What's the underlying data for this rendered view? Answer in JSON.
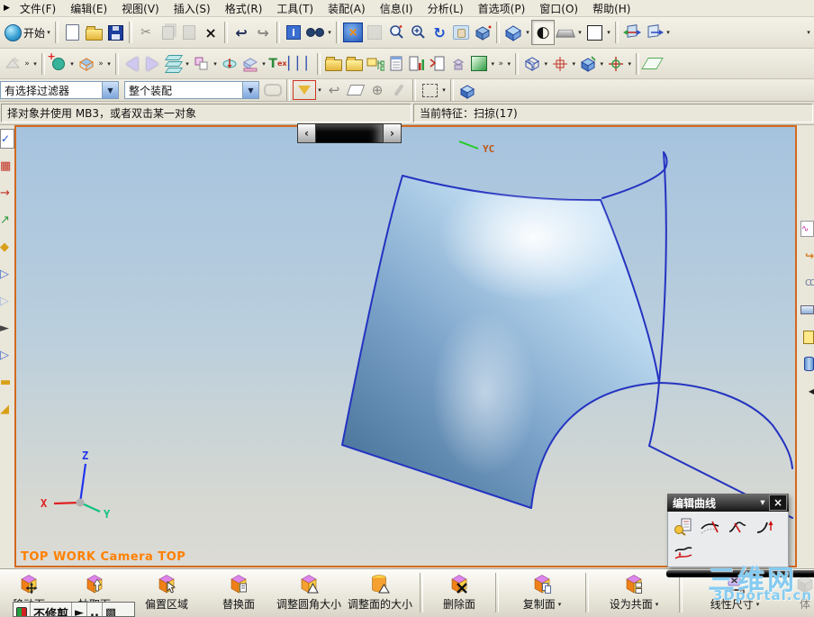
{
  "menu": {
    "items": [
      {
        "label": "文件(F)"
      },
      {
        "label": "编辑(E)"
      },
      {
        "label": "视图(V)"
      },
      {
        "label": "插入(S)"
      },
      {
        "label": "格式(R)"
      },
      {
        "label": "工具(T)"
      },
      {
        "label": "装配(A)"
      },
      {
        "label": "信息(I)"
      },
      {
        "label": "分析(L)"
      },
      {
        "label": "首选项(P)"
      },
      {
        "label": "窗口(O)"
      },
      {
        "label": "帮助(H)"
      }
    ]
  },
  "standard_toolbar": {
    "start_label": "开始"
  },
  "selection_bar": {
    "filter_value": "有选择过滤器",
    "scope_value": "整个装配"
  },
  "prompt_bar": {
    "message": "择对象并使用 MB3，或者双击某一对象",
    "status": "当前特征：扫掠(17)"
  },
  "viewport": {
    "view_label": "TOP WORK Camera TOP",
    "wcs_label": "YC",
    "axis_x": "X",
    "axis_y": "Y",
    "axis_z": "Z"
  },
  "edit_curve_toolbar": {
    "title": "编辑曲线"
  },
  "synchronous_toolbar": {
    "buttons": [
      {
        "label": "移动面"
      },
      {
        "label": "抽取面"
      },
      {
        "label": "偏置区域"
      },
      {
        "label": "替换面"
      },
      {
        "label": "调整圆角大小"
      },
      {
        "label": "调整面的大小"
      },
      {
        "label": "删除面"
      },
      {
        "label": "复制面"
      },
      {
        "label": "设为共面"
      },
      {
        "label": "线性尺寸"
      },
      {
        "label": "体"
      }
    ]
  },
  "snap_popup": {
    "label": "不修剪"
  },
  "watermark": {
    "name": "三维网",
    "domain": "3Dportal.cn"
  }
}
